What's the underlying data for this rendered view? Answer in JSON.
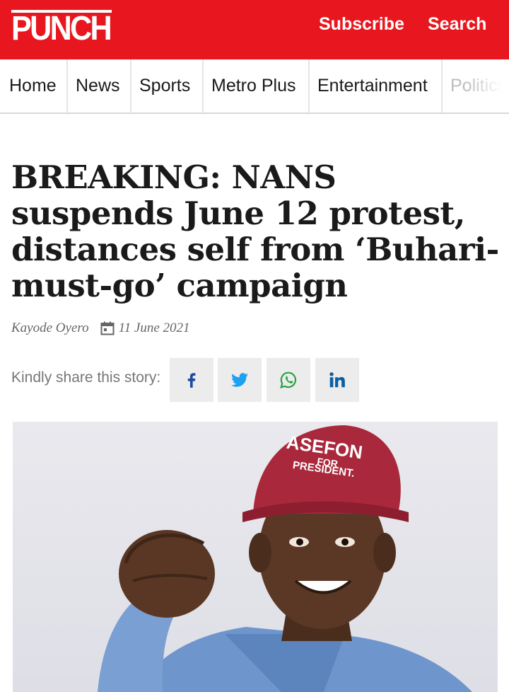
{
  "header": {
    "logo_text": "PUNCH",
    "subscribe_label": "Subscribe",
    "search_label": "Search",
    "brand_color": "#e8161e"
  },
  "nav": {
    "items": [
      "Home",
      "News",
      "Sports",
      "Metro Plus",
      "Entertainment",
      "Politics"
    ]
  },
  "article": {
    "headline": "BREAKING: NANS suspends June 12 protest, distances self from ‘Buhari-must-go’ campaign",
    "author": "Kayode Oyero",
    "date": "11 June 2021",
    "share_label": "Kindly share this story:",
    "share_buttons": [
      "facebook-icon",
      "twitter-icon",
      "whatsapp-icon",
      "linkedin-icon"
    ],
    "cap_text_line1": "ASEFON",
    "cap_text_line2": "FOR",
    "cap_text_line3": "PRESIDENT."
  }
}
